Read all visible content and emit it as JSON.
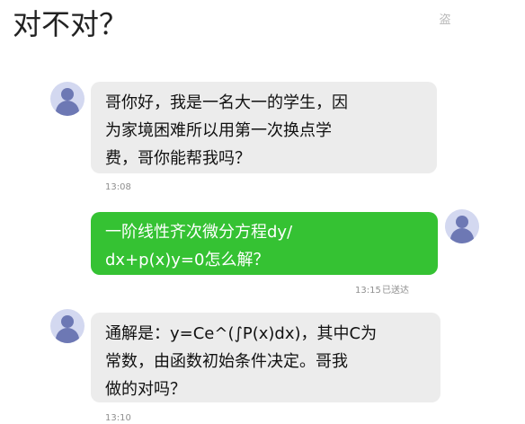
{
  "caption": "对不对？",
  "watermark": "盗",
  "messages": [
    {
      "side": "incoming",
      "text": "哥你好，我是一名大一的学生，因\n为家境困难所以用第一次换点学\n费，哥你能帮我吗？",
      "time": "13:08"
    },
    {
      "side": "outgoing",
      "text": "一阶线性齐次微分方程dy/\ndx+p(x)y=0怎么解？",
      "time": "13:15",
      "status": "已送达"
    },
    {
      "side": "incoming",
      "text": "通解是：y=Ce^(∫P(x)dx)，其中C为\n常数，由函数初始条件决定。哥我\n做的对吗？",
      "time": "13:10"
    }
  ],
  "colors": {
    "incoming_bubble": "#ececec",
    "outgoing_bubble": "#35c233",
    "outgoing_text": "#ffffff",
    "avatar_bg": "#d3d8f0",
    "avatar_fg": "#6d78b4"
  },
  "icons": {
    "avatar": "user-avatar-icon"
  }
}
